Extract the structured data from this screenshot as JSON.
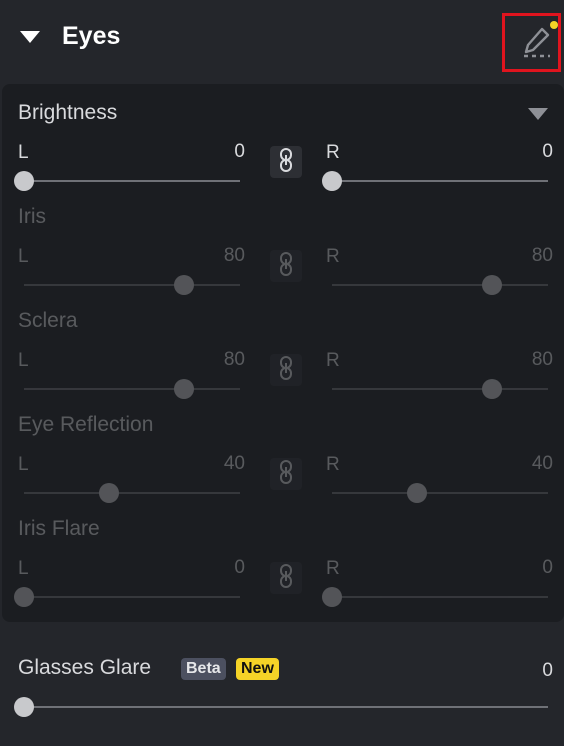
{
  "section": {
    "title": "Eyes"
  },
  "panel": {
    "groups": [
      {
        "id": "brightness",
        "title": "Brightness",
        "left_label": "L",
        "left_value": "0",
        "right_label": "R",
        "right_value": "0",
        "left_fraction": 0.0,
        "right_fraction": 0.0,
        "enabled": true
      },
      {
        "id": "iris",
        "title": "Iris",
        "left_label": "L",
        "left_value": "80",
        "right_label": "R",
        "right_value": "80",
        "left_fraction": 0.8,
        "right_fraction": 0.8,
        "enabled": false
      },
      {
        "id": "sclera",
        "title": "Sclera",
        "left_label": "L",
        "left_value": "80",
        "right_label": "R",
        "right_value": "80",
        "left_fraction": 0.8,
        "right_fraction": 0.8,
        "enabled": false
      },
      {
        "id": "eye-reflection",
        "title": "Eye Reflection",
        "left_label": "L",
        "left_value": "40",
        "right_label": "R",
        "right_value": "40",
        "left_fraction": 0.4,
        "right_fraction": 0.4,
        "enabled": false
      },
      {
        "id": "iris-flare",
        "title": "Iris Flare",
        "left_label": "L",
        "left_value": "0",
        "right_label": "R",
        "right_value": "0",
        "left_fraction": 0.0,
        "right_fraction": 0.0,
        "enabled": false
      }
    ]
  },
  "glasses_glare": {
    "label": "Glasses Glare",
    "badge_beta": "Beta",
    "badge_new": "New",
    "value": "0",
    "fraction": 0.0
  },
  "colors": {
    "accent_yellow": "#f5d327",
    "highlight_red": "#e0141e",
    "panel_bg": "#1b1d21",
    "page_bg": "#24262b"
  }
}
